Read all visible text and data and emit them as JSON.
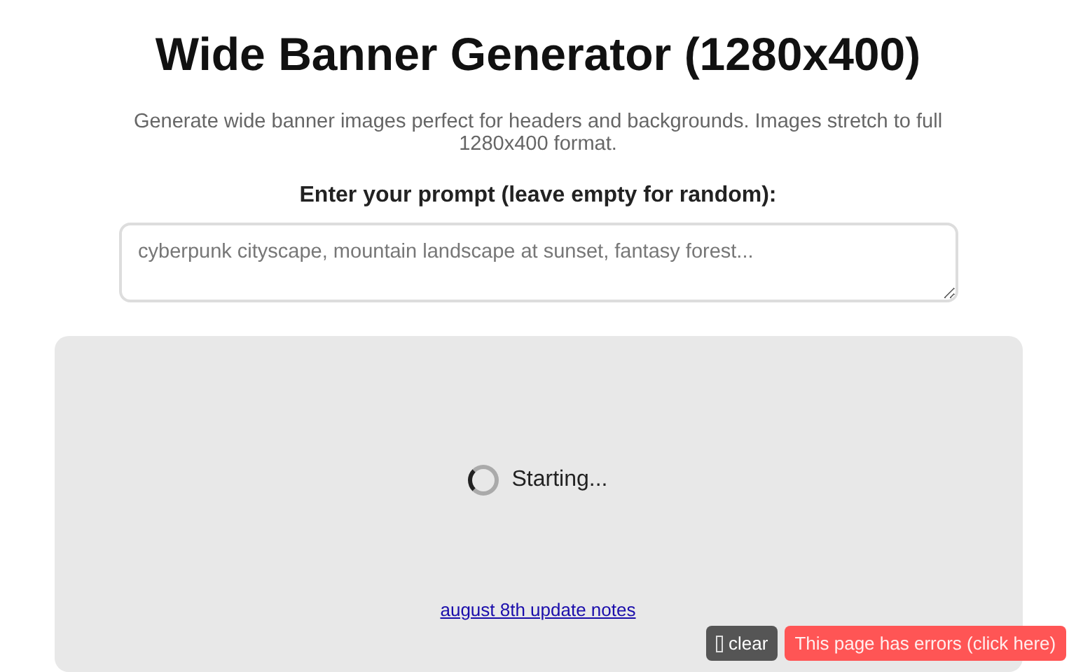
{
  "title": "Wide Banner Generator (1280x400)",
  "subtitle": "Generate wide banner images perfect for headers and backgrounds. Images stretch to full 1280x400 format.",
  "prompt": {
    "label": "Enter your prompt (leave empty for random):",
    "placeholder": "cyberpunk cityscape, mountain landscape at sunset, fantasy forest..."
  },
  "status": {
    "text": "Starting...",
    "loading": true
  },
  "link": "august 8th update notes",
  "clear_button": "clear",
  "error_button": "This page has errors (click here)"
}
